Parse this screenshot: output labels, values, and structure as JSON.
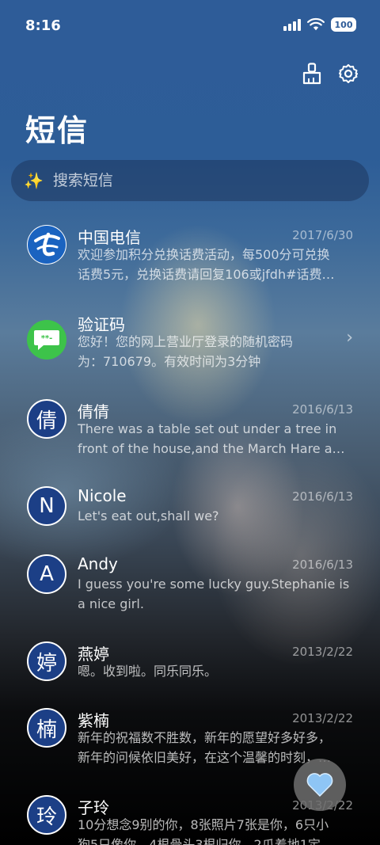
{
  "status": {
    "time": "8:16",
    "battery": "100"
  },
  "header": {
    "title": "短信"
  },
  "search": {
    "placeholder": "搜索短信"
  },
  "messages": [
    {
      "name": "中国电信",
      "date": "2017/6/30",
      "lines": [
        "欢迎参加积分兑换话费活动，每500分可兑换",
        "话费5元，兑换话费请回复106或jfdh#话费…"
      ],
      "avatar": "china-telecom-logo"
    },
    {
      "name": "验证码",
      "date": "",
      "lines": [
        "您好！您的网上营业厅登录的随机密码",
        "为：710679。有效时间为3分钟"
      ],
      "avatar": "message-bubble-icon",
      "avatar_text": "**-"
    },
    {
      "name": "倩倩",
      "date": "2016/6/13",
      "lines": [
        "There was a table set out under a tree in",
        "front of the house,and the March Hare an…"
      ],
      "avatar": "倩"
    },
    {
      "name": "Nicole",
      "date": "2016/6/13",
      "lines": [
        "Let's eat out,shall we?"
      ],
      "avatar": "N"
    },
    {
      "name": "Andy",
      "date": "2016/6/13",
      "lines": [
        "I guess you're some lucky guy.Stephanie is",
        "a nice girl."
      ],
      "avatar": "A"
    },
    {
      "name": "燕婷",
      "date": "2013/2/22",
      "lines": [
        "嗯。收到啦。同乐同乐。"
      ],
      "avatar": "婷"
    },
    {
      "name": "紫楠",
      "date": "2013/2/22",
      "lines": [
        "新年的祝福数不胜数，新年的愿望好多好多，",
        "新年的问候依旧美好，在这个温馨的时刻，…"
      ],
      "avatar": "楠"
    },
    {
      "name": "子玲",
      "date": "2013/2/22",
      "lines": [
        "10分想念9别的你，8张照片7张是你，6只小",
        "狗5只像你，4根骨头3根归你，2爪着地1定…"
      ],
      "avatar": "玲"
    }
  ],
  "icons": {
    "clean": "broom-icon",
    "settings": "gear-icon",
    "search": "sparkle-icon",
    "fab": "heart-icon"
  },
  "colors": {
    "avatar_bg": "#1c3f86",
    "chat_green": "#3dc34a",
    "heart": "#8ec5f5"
  }
}
